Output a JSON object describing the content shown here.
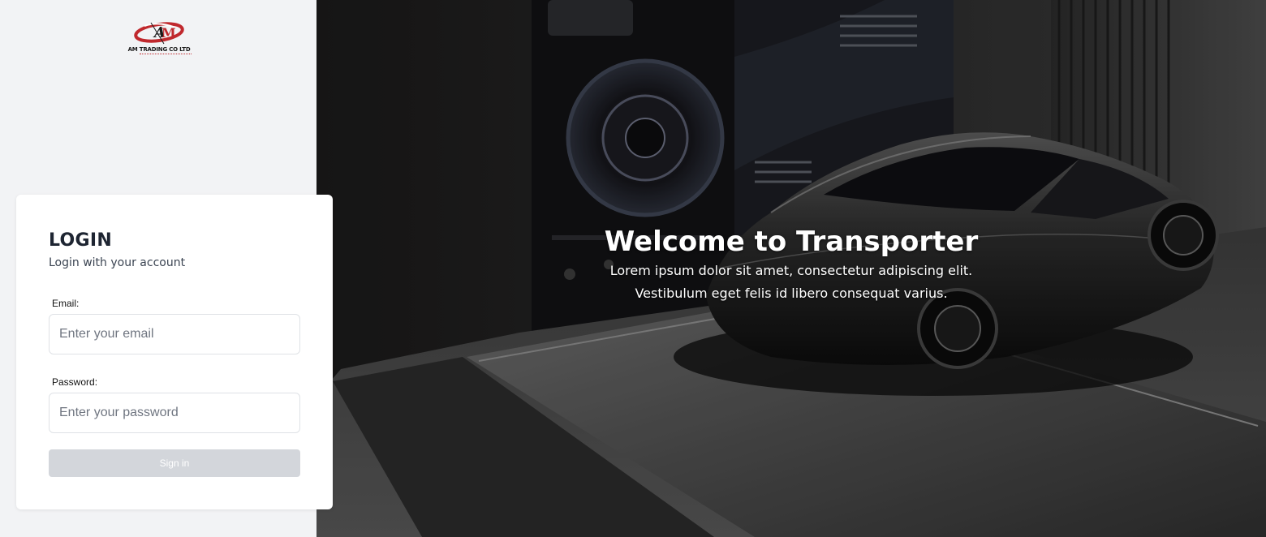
{
  "brand": {
    "name": "AM TRADING CO LTD",
    "accent_color": "#c0282d"
  },
  "login": {
    "title": "LOGIN",
    "subtitle": "Login with your account",
    "email": {
      "label": "Email:",
      "placeholder": "Enter your email",
      "value": ""
    },
    "password": {
      "label": "Password:",
      "placeholder": "Enter your password",
      "value": ""
    },
    "submit_label": "Sign in",
    "submit_color": "#d3d6db"
  },
  "hero": {
    "title": "Welcome to Transporter",
    "lines": [
      "Lorem ipsum dolor sit amet, consectetur adipiscing elit.",
      "Vestibulum eget felis id libero consequat varius."
    ],
    "image": "car-showroom-image"
  }
}
